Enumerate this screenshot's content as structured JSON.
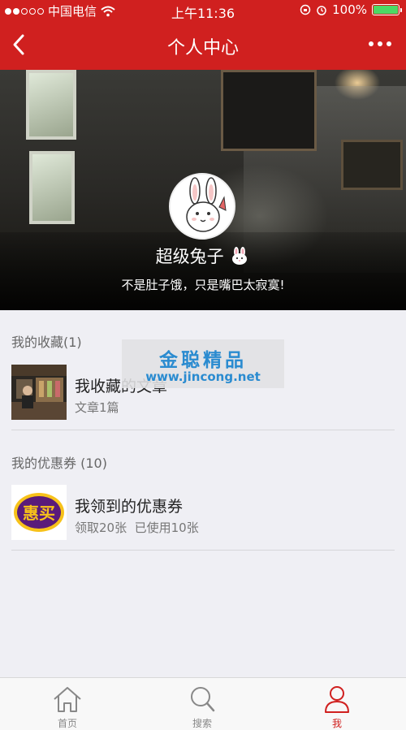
{
  "status_bar": {
    "carrier": "中国电信",
    "time": "上午11:36",
    "battery": "100%"
  },
  "nav": {
    "title": "个人中心"
  },
  "profile": {
    "name": "超级兔子",
    "signature": "不是肚子饿，只是嘴巴太寂寞!"
  },
  "favorites": {
    "header": "我的收藏(1)",
    "item_title": "我收藏的文章",
    "item_sub": "文章1篇"
  },
  "coupons": {
    "header": "我的优惠券 (10)",
    "item_title": "我领到的优惠券",
    "item_sub": "领取20张  已使用10张",
    "logo_text": "惠买"
  },
  "watermark": {
    "brand": "金聪精品",
    "url": "www.jincong.net"
  },
  "tabbar": {
    "tabs": [
      {
        "label": "首页",
        "icon": "home-icon",
        "active": false
      },
      {
        "label": "搜索",
        "icon": "search-icon",
        "active": false
      },
      {
        "label": "我",
        "icon": "person-icon",
        "active": true
      }
    ]
  },
  "colors": {
    "brand_red": "#d0201f",
    "watermark_blue": "#2a8bd0",
    "battery_green": "#4cd964"
  }
}
